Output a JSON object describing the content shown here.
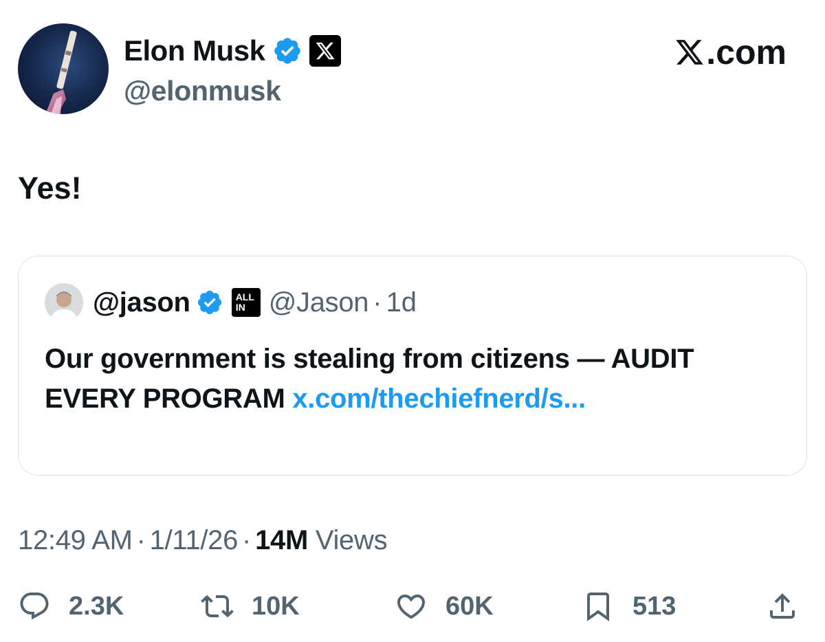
{
  "header": {
    "display_name": "Elon Musk",
    "handle": "@elonmusk",
    "brand_text": ".com",
    "verified_icon": "verified-badge-icon",
    "affiliation_icon": "x-logo-icon"
  },
  "tweet": {
    "text": "Yes!"
  },
  "quote": {
    "display_name": "@jason",
    "affiliation_badge_line1": "ALL",
    "affiliation_badge_line2": "IN",
    "handle": "@Jason",
    "separator": "·",
    "time": "1d",
    "text": "Our government is stealing from citizens — AUDIT EVERY PROGRAM",
    "link": "x.com/thechiefnerd/s..."
  },
  "meta": {
    "time": "12:49 AM",
    "separator": "·",
    "date": "1/11/26",
    "views_count": "14M",
    "views_label": "Views"
  },
  "actions": {
    "replies": "2.3K",
    "reposts": "10K",
    "likes": "60K",
    "bookmarks": "513"
  },
  "colors": {
    "text": "#0f1419",
    "secondary": "#536471",
    "link": "#1d9bf0",
    "verified": "#1d9bf0",
    "border": "#dfe3e6"
  }
}
